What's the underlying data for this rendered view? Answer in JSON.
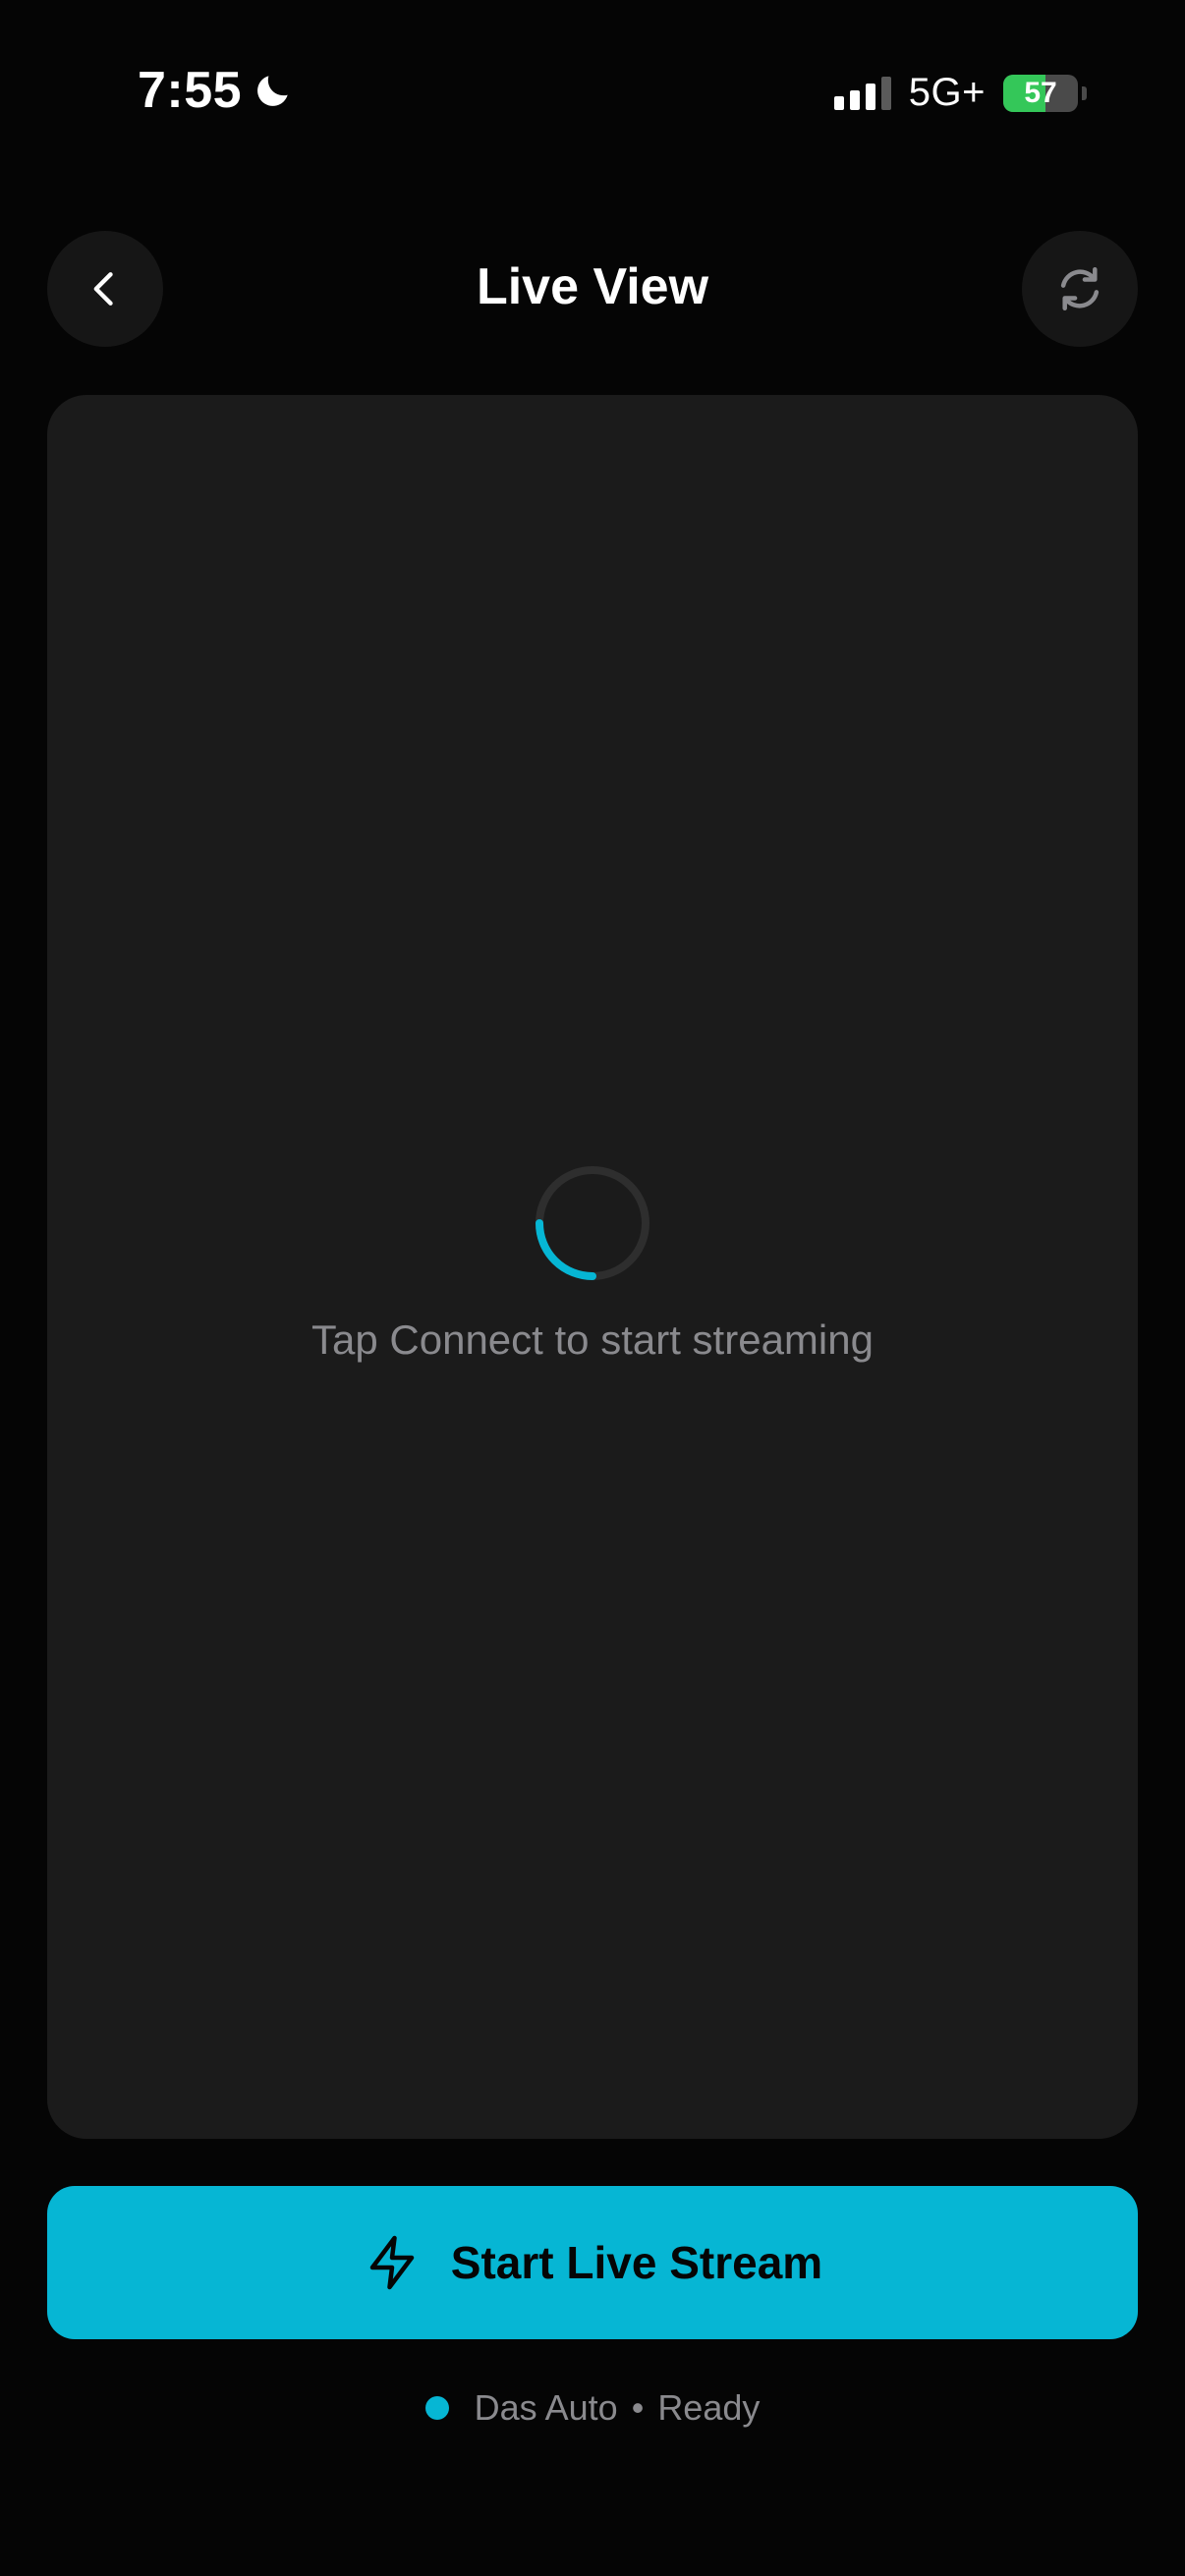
{
  "status_bar": {
    "time": "7:55",
    "network": "5G+",
    "battery": "57",
    "battery_level": 0.57
  },
  "header": {
    "title": "Live View"
  },
  "video": {
    "hint": "Tap Connect to start streaming"
  },
  "cta": {
    "label": "Start Live Stream"
  },
  "device": {
    "name": "Das Auto",
    "separator": "•",
    "state": "Ready"
  },
  "colors": {
    "accent": "#06b6d4",
    "background": "#050505",
    "panel": "#1b1b1b",
    "muted_text": "#8a8a8e",
    "battery_green": "#34c759"
  },
  "icons": {
    "back": "chevron-left-icon",
    "refresh": "refresh-icon",
    "cta": "lightning-bolt-icon",
    "status_time": "moon-icon"
  }
}
